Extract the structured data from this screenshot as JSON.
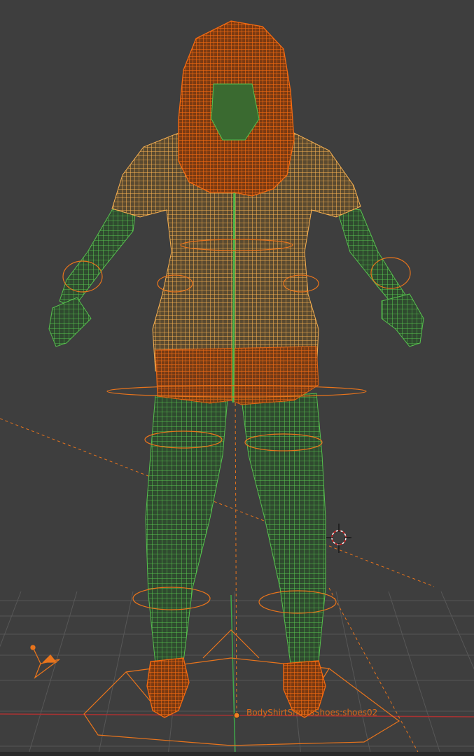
{
  "viewport": {
    "background": "#3e3e3e",
    "selected_object_label": "BodyShirtShortsShoes:shoes02",
    "overlapping_labels": [
      "Shirt",
      "Shorts",
      "Body"
    ]
  },
  "colors": {
    "wire_selected": "#f26a10",
    "wire_active_light": "#f5a040",
    "wire_unselected": "#4fb84a",
    "grid": "#5a5a5a",
    "axis_green": "#3fa84a",
    "axis_red": "#b03030",
    "origin_dot": "#f28020"
  },
  "icons": {
    "cursor": "3d-cursor-icon",
    "camera": "camera-icon",
    "lamp": "lamp-icon"
  }
}
